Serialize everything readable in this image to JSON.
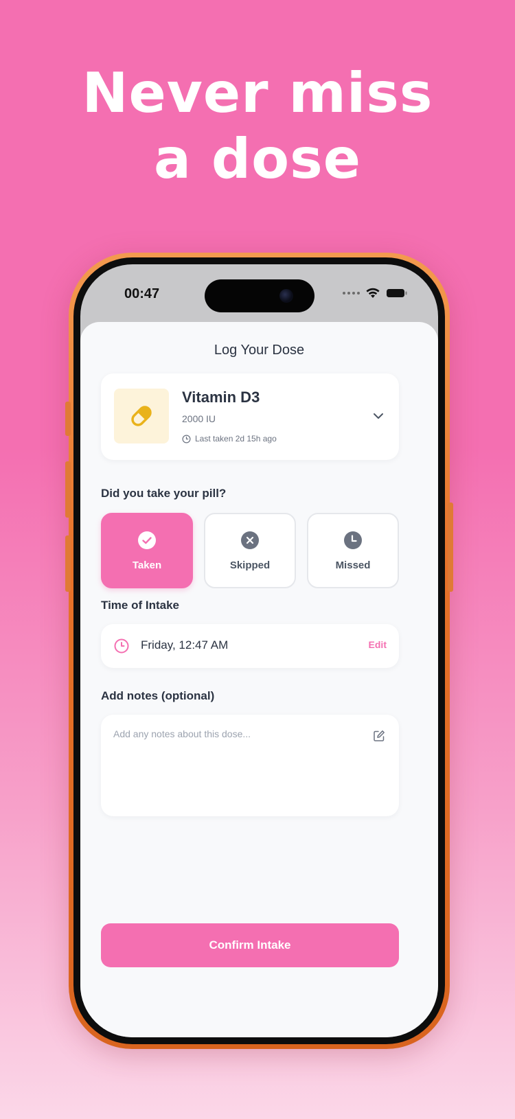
{
  "promo": {
    "headline_line1": "Never miss",
    "headline_line2": "a dose"
  },
  "status_bar": {
    "time": "00:47",
    "icons": [
      "signal-dots-icon",
      "wifi-icon",
      "battery-icon"
    ]
  },
  "screen": {
    "title": "Log Your Dose"
  },
  "medication": {
    "name": "Vitamin D3",
    "dose": "2000 IU",
    "last_taken": "Last taken 2d 15h ago",
    "icon": "pill-icon"
  },
  "intake_question": {
    "label": "Did you take your pill?",
    "options": [
      {
        "label": "Taken",
        "icon": "check-circle-icon",
        "selected": true
      },
      {
        "label": "Skipped",
        "icon": "x-circle-icon",
        "selected": false
      },
      {
        "label": "Missed",
        "icon": "clock-icon",
        "selected": false
      }
    ]
  },
  "time_of_intake": {
    "label": "Time of Intake",
    "value": "Friday, 12:47 AM",
    "edit_label": "Edit"
  },
  "notes": {
    "label": "Add notes (optional)",
    "placeholder": "Add any notes about this dose...",
    "value": ""
  },
  "confirm": {
    "label": "Confirm Intake"
  },
  "colors": {
    "accent": "#f46fb1",
    "background_top": "#f46fb1",
    "background_bottom": "#fbd7e8",
    "phone_frame": "#e6722a",
    "pill_tint": "#fdf3da",
    "pill_icon": "#e9b21a"
  }
}
